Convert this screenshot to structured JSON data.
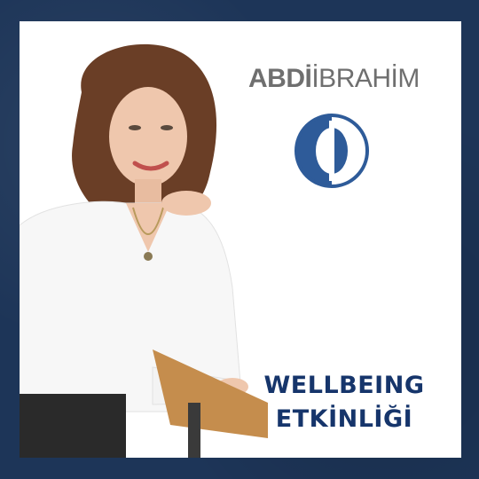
{
  "brand": {
    "name_bold": "ABDİ",
    "name_light": "İBRAHİM",
    "accent_color": "#2e5b99"
  },
  "headline": {
    "line1": "WELLBEING",
    "line2": "ETKİNLİĞİ",
    "color": "#16356b"
  },
  "image": {
    "subject": "woman-portrait-photo"
  }
}
